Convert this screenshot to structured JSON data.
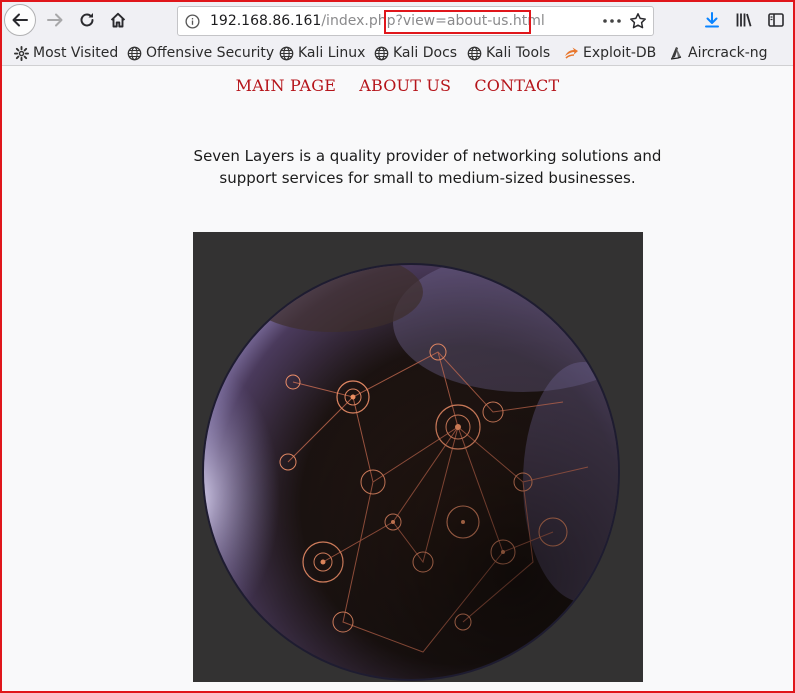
{
  "browser": {
    "url": {
      "host": "192.168.86.161",
      "path": "/index.php?view=about-us.html"
    },
    "bookmarks": [
      {
        "label": "Most Visited",
        "icon": "gear-icon"
      },
      {
        "label": "Offensive Security",
        "icon": "globe-icon"
      },
      {
        "label": "Kali Linux",
        "icon": "globe-icon"
      },
      {
        "label": "Kali Docs",
        "icon": "globe-icon"
      },
      {
        "label": "Kali Tools",
        "icon": "globe-icon"
      },
      {
        "label": "Exploit-DB",
        "icon": "exploit-db-icon"
      },
      {
        "label": "Aircrack-ng",
        "icon": "aircrack-icon"
      }
    ],
    "highlight_color": "#e0161b"
  },
  "site": {
    "nav": [
      {
        "label": "MAIN PAGE"
      },
      {
        "label": "ABOUT US"
      },
      {
        "label": "CONTACT"
      }
    ],
    "intro_line1": "Seven Layers is a quality provider of networking solutions and",
    "intro_line2": "support services for small to medium-sized businesses.",
    "link_color": "#b5141a"
  }
}
